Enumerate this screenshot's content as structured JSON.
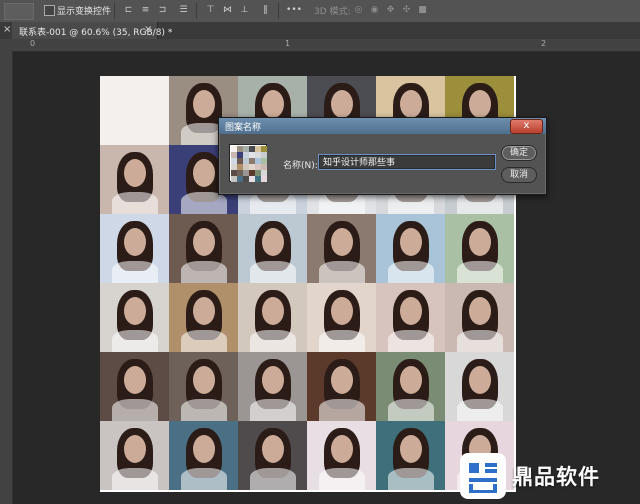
{
  "options_bar": {
    "show_transform_controls_label": "显示变换控件",
    "mode_3d_label": "3D 模式:",
    "more_label": "•••"
  },
  "tab": {
    "title": "联系表-001 @ 60.6% (35, RGB/8) *",
    "close_glyph": "×"
  },
  "ruler": {
    "marks": [
      "0",
      "1",
      "2"
    ]
  },
  "dialog": {
    "title": "图案名称",
    "close_glyph": "x",
    "name_label": "名称(N):",
    "name_value": "知乎设计师那些事",
    "ok_label": "确定",
    "cancel_label": "取消"
  },
  "watermark": {
    "text": "鼎品软件"
  },
  "grid": {
    "rows": 6,
    "cols": 6,
    "palette": [
      [
        "#f4f0ee",
        "#9a8d82",
        "#a7b0a9",
        "#4c4d52",
        "#d9c49f",
        "#9c8f3b"
      ],
      [
        "#c9b6ad",
        "#3b3f78",
        "#cad3dd",
        "#e1e3e7",
        "#d7d9dc",
        "#c7ccd1"
      ],
      [
        "#cfd8e6",
        "#6d5b52",
        "#bcc9d3",
        "#8a7a6f",
        "#a9c3d9",
        "#a9c0a5"
      ],
      [
        "#d7d3cf",
        "#b08f6b",
        "#d3c8bd",
        "#e2d5cc",
        "#d7c4bf",
        "#c9b9b2"
      ],
      [
        "#5d4c45",
        "#6e6159",
        "#9b9593",
        "#5b3a2c",
        "#7a8c73",
        "#d8d8d8"
      ],
      [
        "#c9c3c2",
        "#4b6f84",
        "#4f4a4c",
        "#e8dfe4",
        "#3f6f7a",
        "#e7d6dd"
      ]
    ]
  }
}
